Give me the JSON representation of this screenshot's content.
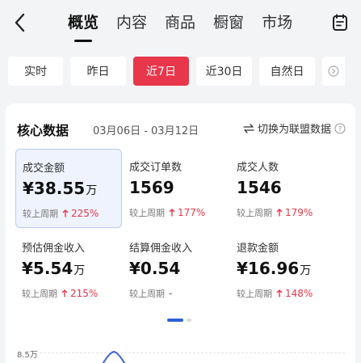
{
  "nav": {
    "tabs": [
      {
        "label": "概览",
        "active": true
      },
      {
        "label": "内容",
        "active": false
      },
      {
        "label": "商品",
        "active": false
      },
      {
        "label": "橱窗",
        "active": false
      },
      {
        "label": "市场",
        "active": false
      }
    ],
    "back_icon": "chevron-left-icon",
    "right_icon": "notepad-icon"
  },
  "date_chips": [
    {
      "label": "实时",
      "active": false
    },
    {
      "label": "昨日",
      "active": false
    },
    {
      "label": "近7日",
      "active": true
    },
    {
      "label": "近30日",
      "active": false
    },
    {
      "label": "自然日",
      "active": false
    }
  ],
  "core": {
    "title": "核心数据",
    "range": "03月06日 - 03月12日",
    "switch_label": "切换为联盟数据",
    "metrics": [
      {
        "label": "成交金额",
        "prefix": "¥",
        "value": "38.55",
        "unit": "万",
        "compare_label": "较上周期",
        "delta": "225%",
        "trend": "up",
        "selected": true
      },
      {
        "label": "成交订单数",
        "prefix": "",
        "value": "1569",
        "unit": "",
        "compare_label": "较上周期",
        "delta": "177%",
        "trend": "up",
        "selected": false
      },
      {
        "label": "成交人数",
        "prefix": "",
        "value": "1546",
        "unit": "",
        "compare_label": "较上周期",
        "delta": "179%",
        "trend": "up",
        "selected": false
      },
      {
        "label": "预估佣金收入",
        "prefix": "¥",
        "value": "5.54",
        "unit": "万",
        "compare_label": "较上周期",
        "delta": "215%",
        "trend": "up",
        "selected": false
      },
      {
        "label": "结算佣金收入",
        "prefix": "¥",
        "value": "0.54",
        "unit": "",
        "compare_label": "较上周期",
        "delta": "-",
        "trend": "none",
        "selected": false
      },
      {
        "label": "退款金额",
        "prefix": "¥",
        "value": "16.96",
        "unit": "万",
        "compare_label": "较上周期",
        "delta": "148%",
        "trend": "up",
        "selected": false
      }
    ],
    "pager": {
      "pages": 2,
      "current": 1
    },
    "chart_peek": {
      "y_tick": "8.5万",
      "line_color": "#3a63d8"
    }
  },
  "colors": {
    "accent_red": "#e8364a",
    "accent_blue": "#2f5fd8",
    "selected_bg": "#eef3fd"
  }
}
